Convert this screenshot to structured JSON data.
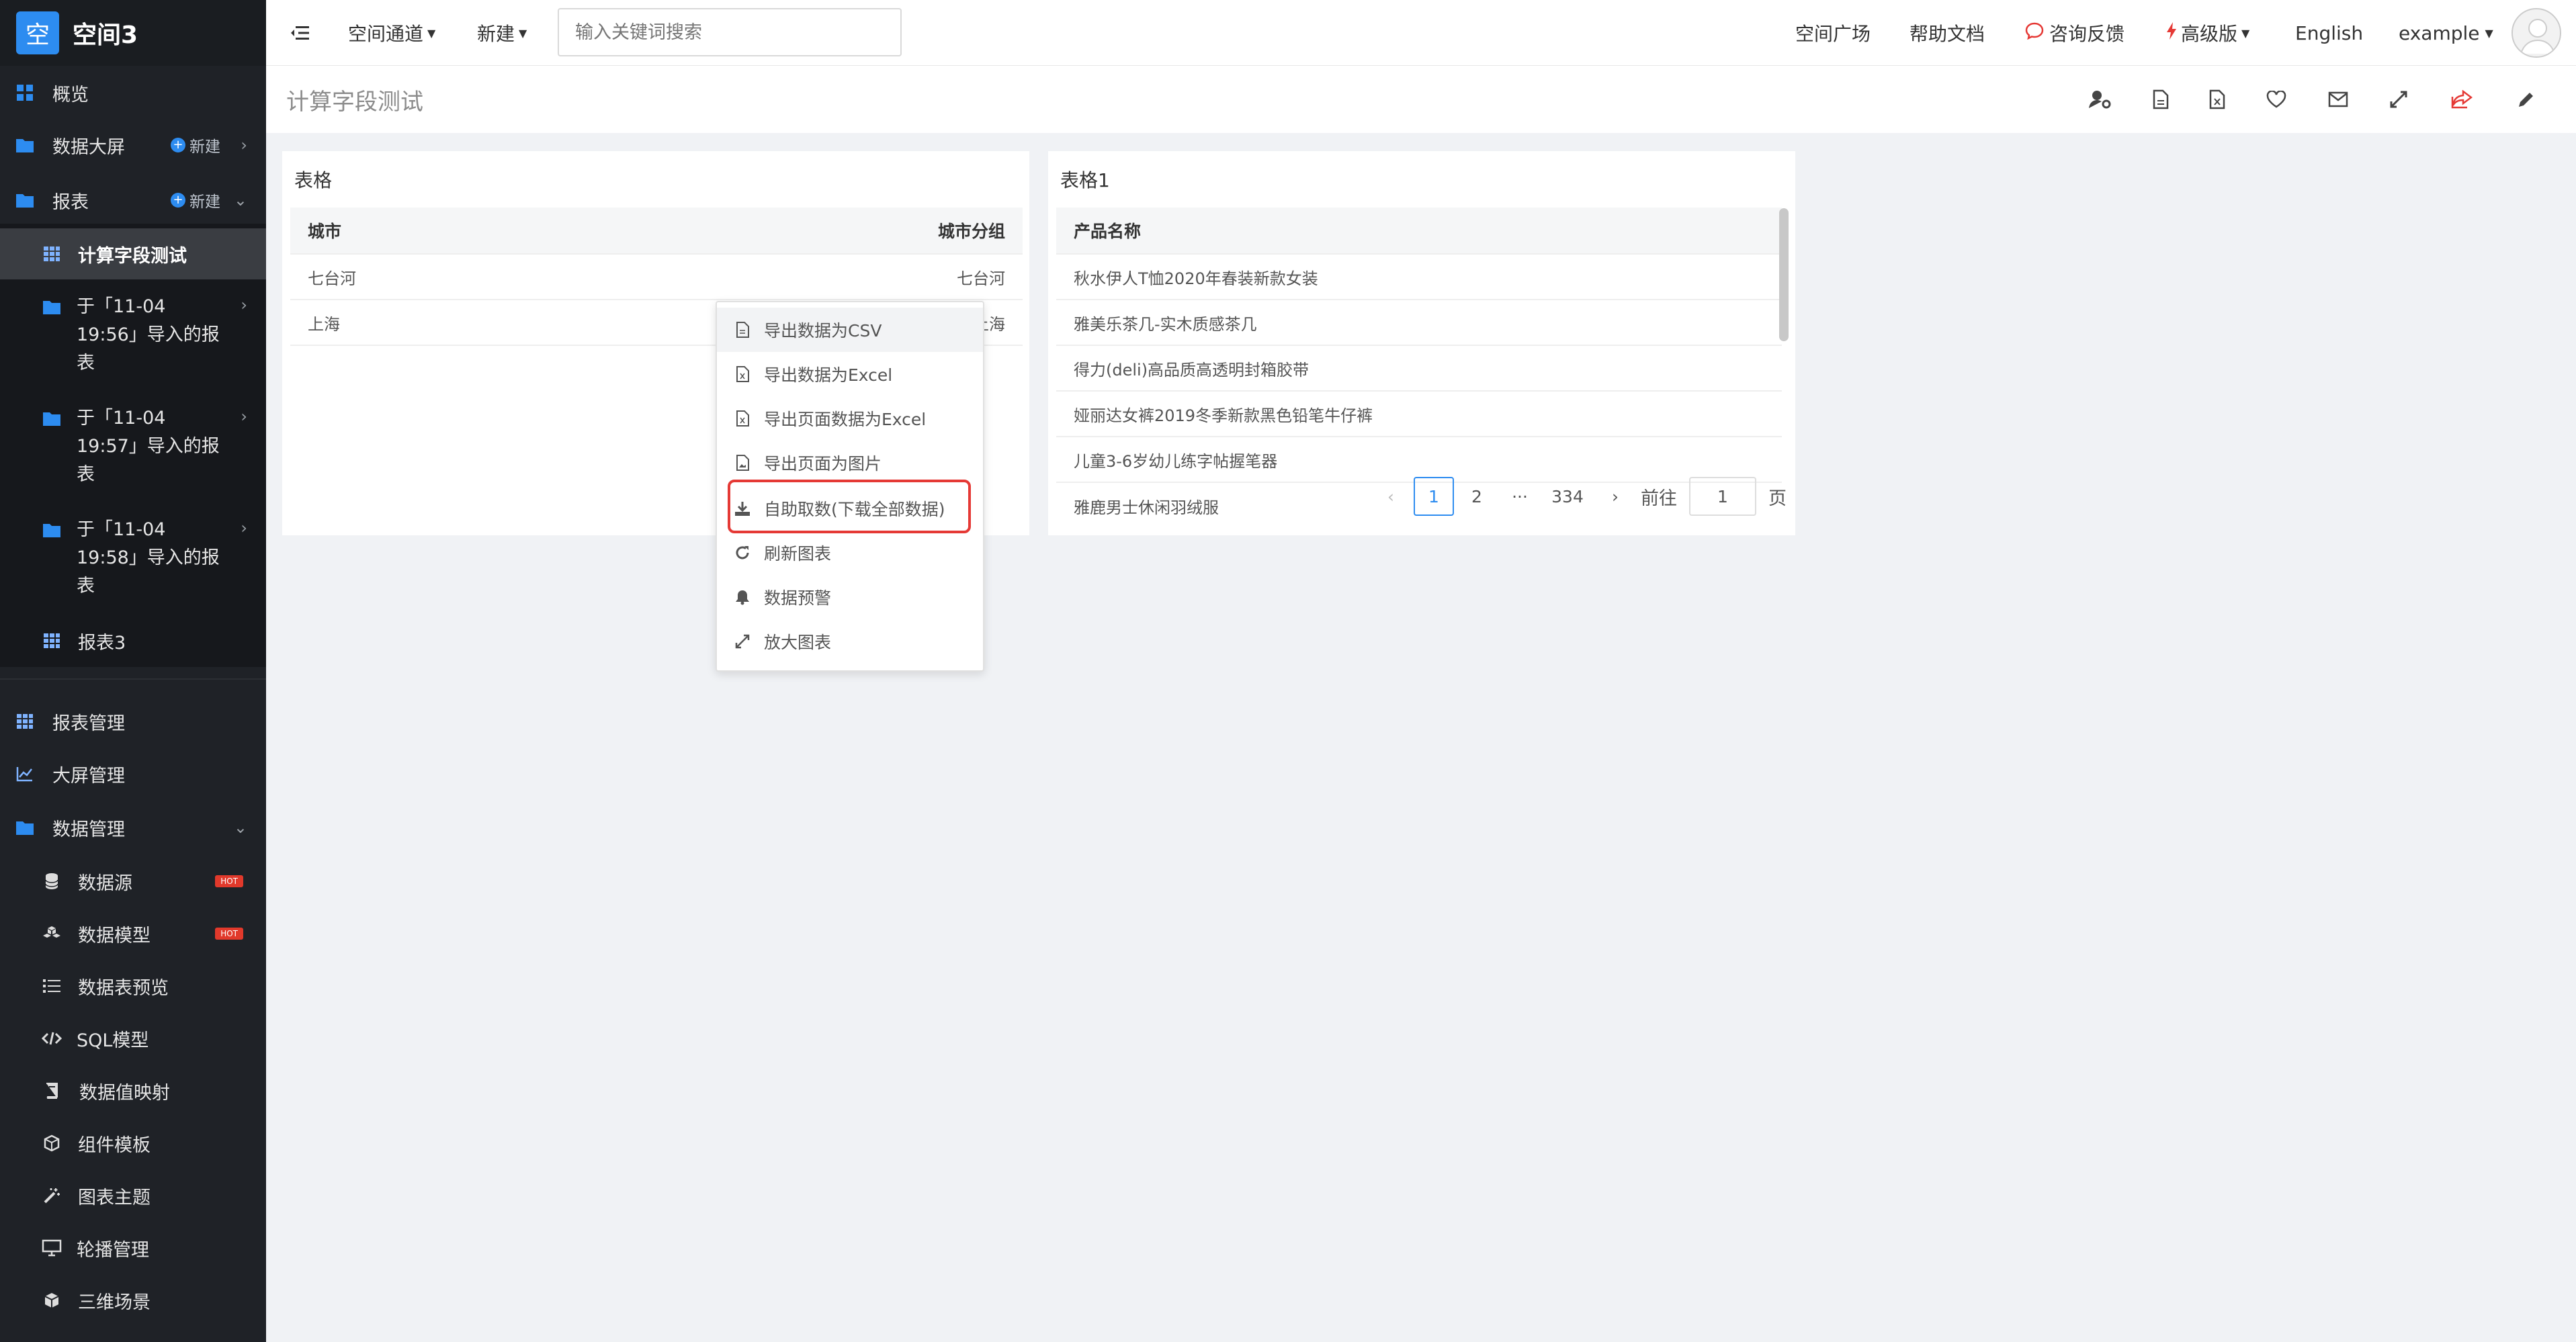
{
  "app": {
    "logo_char": "空",
    "title": "空间3"
  },
  "sidebar": {
    "overview": "概览",
    "datascreen": "数据大屏",
    "reports": "报表",
    "new_label": "新建",
    "report_items": [
      {
        "label": "计算字段测试"
      },
      {
        "label": "于「11-04 19:56」导入的报表"
      },
      {
        "label": "于「11-04 19:57」导入的报表"
      },
      {
        "label": "于「11-04 19:58」导入的报表"
      },
      {
        "label": "报表3"
      }
    ],
    "report_mgmt": "报表管理",
    "screen_mgmt": "大屏管理",
    "data_mgmt": "数据管理",
    "data_items": [
      {
        "label": "数据源",
        "badge": "HOT"
      },
      {
        "label": "数据模型",
        "badge": "HOT"
      },
      {
        "label": "数据表预览"
      },
      {
        "label": "SQL模型"
      },
      {
        "label": "数据值映射"
      },
      {
        "label": "组件模板"
      },
      {
        "label": "图表主题"
      },
      {
        "label": "轮播管理"
      },
      {
        "label": "三维场景"
      }
    ]
  },
  "topbar": {
    "space_channel": "空间通道",
    "new": "新建",
    "search_placeholder": "输入关键词搜索",
    "plaza": "空间广场",
    "help": "帮助文档",
    "feedback": "咨询反馈",
    "premium": "高级版",
    "language": "English",
    "user": "example"
  },
  "page": {
    "title": "计算字段测试"
  },
  "table_left": {
    "title": "表格",
    "columns": [
      "城市",
      "城市分组"
    ],
    "rows": [
      [
        "七台河",
        "七台河"
      ],
      [
        "上海",
        "上海"
      ]
    ]
  },
  "table_right": {
    "title": "表格1",
    "column": "产品名称",
    "rows": [
      "秋水伊人T恤2020年春装新款女装",
      "雅美乐茶几-实木质感茶几",
      "得力(deli)高品质高透明封箱胶带",
      "娅丽达女裤2019冬季新款黑色铅笔牛仔裤",
      "儿童3-6岁幼儿练字帖握笔器",
      "雅鹿男士休闲羽绒服"
    ],
    "pager": {
      "p1": "1",
      "p2": "2",
      "ellipsis": "···",
      "last": "334",
      "goto": "前往",
      "goto_value": "1",
      "page_suffix": "页"
    }
  },
  "menu": {
    "items": [
      "导出数据为CSV",
      "导出数据为Excel",
      "导出页面数据为Excel",
      "导出页面为图片",
      "自助取数(下载全部数据)",
      "刷新图表",
      "数据预警",
      "放大图表"
    ]
  },
  "colors": {
    "accent": "#2d8cf0",
    "sidebar_bg": "#1f2227",
    "highlight": "#e53935",
    "hot": "#e1392b"
  }
}
